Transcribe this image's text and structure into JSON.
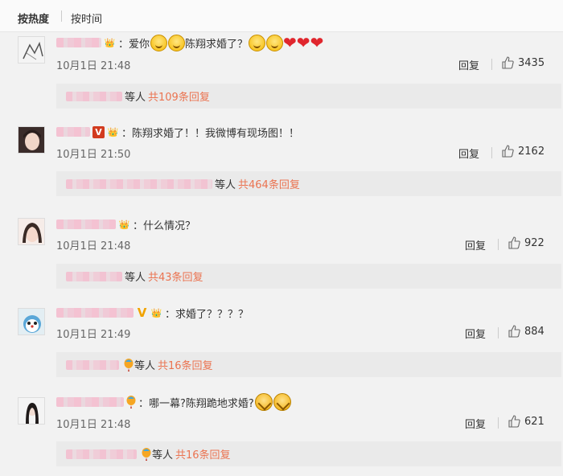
{
  "sort_tabs": {
    "hot": "按热度",
    "time": "按时间"
  },
  "comments": [
    {
      "text_before": "：爱你",
      "text_mid": "陈翔求婚了？",
      "time": "10月1日 21:48",
      "reply": "回复",
      "likes": "3435",
      "sub_etc": "等人",
      "sub_link": "共109条回复"
    },
    {
      "text": "：陈翔求婚了！！我微博有现场图！！",
      "time": "10月1日 21:50",
      "reply": "回复",
      "likes": "2162",
      "sub_etc": "等人",
      "sub_link": "共464条回复"
    },
    {
      "text": "：什么情况？",
      "time": "10月1日 21:48",
      "reply": "回复",
      "likes": "922",
      "sub_etc": "等人",
      "sub_link": "共43条回复"
    },
    {
      "text": "：求婚了？？？？",
      "time": "10月1日 21:49",
      "reply": "回复",
      "likes": "884",
      "sub_etc": "等人",
      "sub_link": "共16条回复"
    },
    {
      "text": "：哪一幕?陈翔跪地求婚?",
      "time": "10月1日 21:48",
      "reply": "回复",
      "likes": "621",
      "sub_etc": "等人",
      "sub_link": "共16条回复"
    }
  ],
  "colors": {
    "link": "#eb7350",
    "heart": "#e0262d",
    "verified_red": "#d23b1f",
    "verified_gold": "#f1a300"
  },
  "icons": {
    "like": "thumbs-up-icon",
    "emoji_smile": "smile-emoji-icon",
    "heart": "heart-icon",
    "emoji_shy": "shy-emoji-icon"
  }
}
